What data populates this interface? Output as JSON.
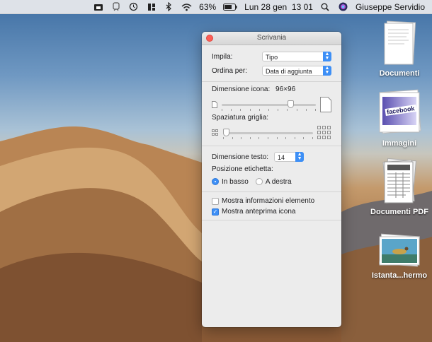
{
  "menubar": {
    "battery": "63%",
    "datetime": "Lun 28 gen  13 01",
    "user": "Giuseppe Servidio"
  },
  "desktop": {
    "items": [
      {
        "label": "Documenti"
      },
      {
        "label": "Immagini"
      },
      {
        "label": "Documenti PDF"
      },
      {
        "label": "Istanta...hermo"
      }
    ],
    "facebook_text": "facebook"
  },
  "window": {
    "title": "Scrivania",
    "impila_label": "Impila:",
    "impila_value": "Tipo",
    "ordina_label": "Ordina per:",
    "ordina_value": "Data di aggiunta",
    "icon_size_label": "Dimensione icona:",
    "icon_size_value": "96×96",
    "icon_size_level": 0.75,
    "grid_spacing_label": "Spaziatura griglia:",
    "grid_spacing_level": 0.0,
    "text_size_label": "Dimensione testo:",
    "text_size_value": "14",
    "label_position_label": "Posizione etichetta:",
    "pos_bottom": "In basso",
    "pos_right": "A destra",
    "show_info": "Mostra informazioni elemento",
    "show_info_checked": false,
    "show_preview": "Mostra anteprima icona",
    "show_preview_checked": true
  },
  "colors": {
    "accent": "#3d8ff6",
    "close": "#fd5f57"
  }
}
